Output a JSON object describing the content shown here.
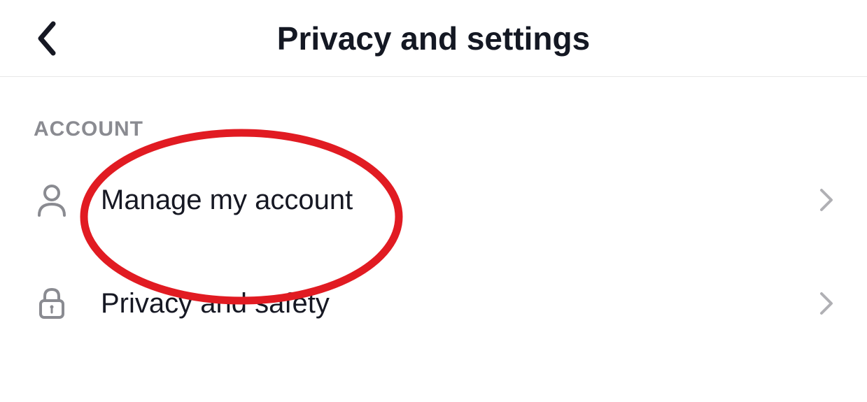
{
  "header": {
    "title": "Privacy and settings"
  },
  "section": {
    "label": "ACCOUNT",
    "items": [
      {
        "label": "Manage my account"
      },
      {
        "label": "Privacy and safety"
      }
    ]
  }
}
